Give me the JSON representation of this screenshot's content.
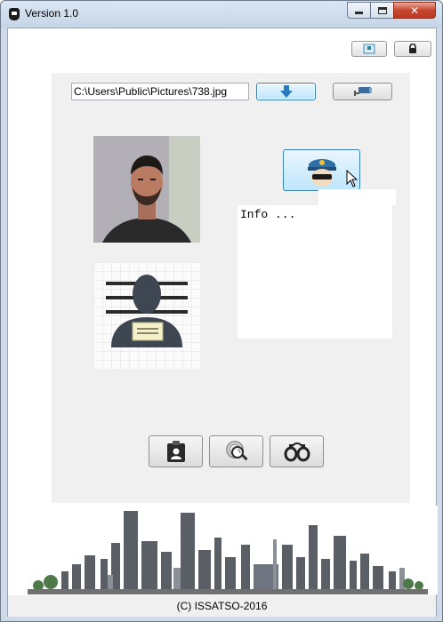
{
  "window": {
    "title": "Version 1.0",
    "close_glyph": "✕"
  },
  "toolbar": {
    "info_icon": "id-card-icon",
    "lock_icon": "lock-icon"
  },
  "file": {
    "path": "C:\\Users\\Public\\Pictures\\738.jpg"
  },
  "buttons": {
    "download_icon": "download-arrow-icon",
    "camera_icon": "security-camera-icon",
    "police_icon": "police-officer-icon"
  },
  "info": {
    "text": "Info ..."
  },
  "actions": [
    {
      "icon": "id-badge-icon"
    },
    {
      "icon": "fingerprint-search-icon"
    },
    {
      "icon": "handcuffs-icon"
    }
  ],
  "footer": {
    "text": "(C) ISSATSO-2016"
  },
  "colors": {
    "accent": "#3c7fb1",
    "panel": "#f0f0f0",
    "close": "#c8452d"
  }
}
